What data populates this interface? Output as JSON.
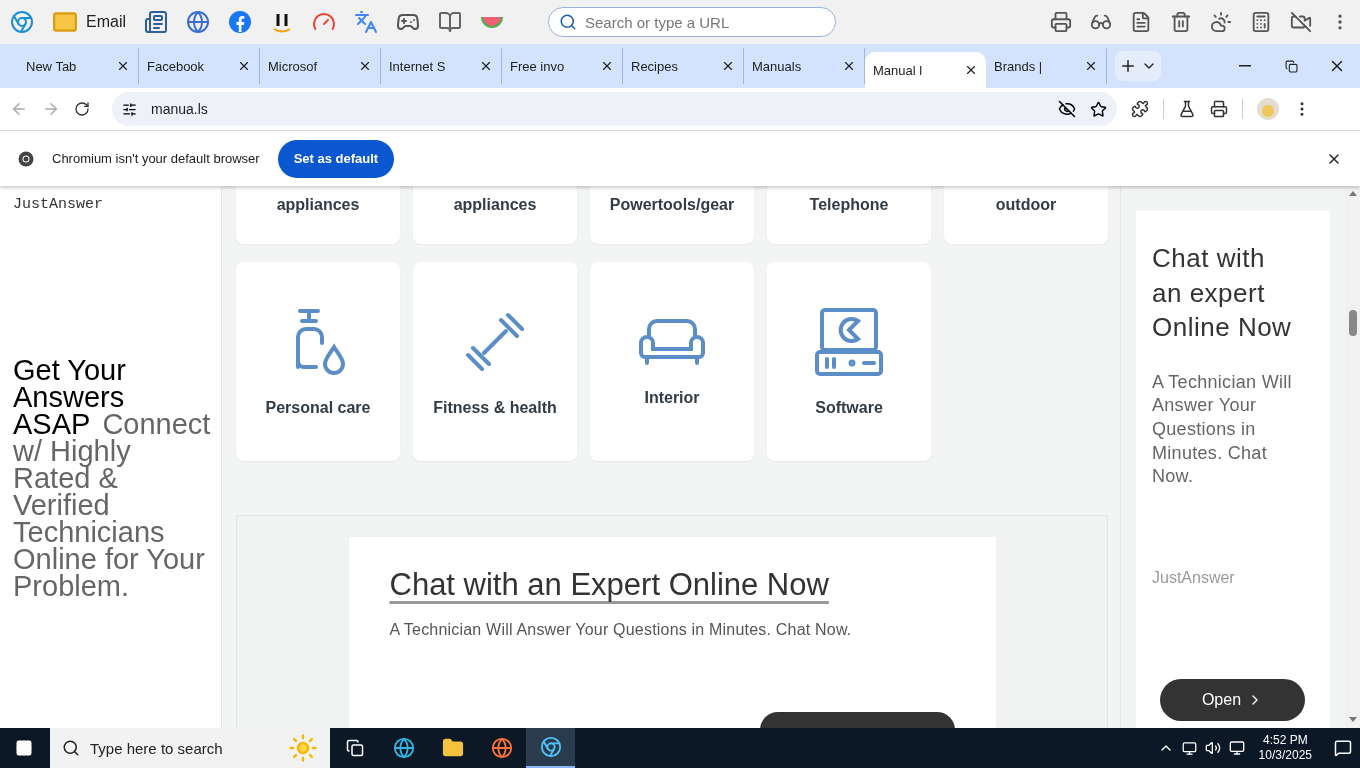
{
  "toolbar": {
    "bookmark_label": "Email",
    "search_placeholder": "Search or type a URL"
  },
  "tabs": [
    {
      "title": "New Tab",
      "selected": false
    },
    {
      "title": "Facebook",
      "selected": false
    },
    {
      "title": "Microsof",
      "selected": false
    },
    {
      "title": "Internet S",
      "selected": false
    },
    {
      "title": "Free invo",
      "selected": false
    },
    {
      "title": "Recipes",
      "selected": false
    },
    {
      "title": "Manuals",
      "selected": false
    },
    {
      "title": "Manual l",
      "selected": true
    },
    {
      "title": "Brands |",
      "selected": false
    }
  ],
  "address": "manua.ls",
  "infobar": {
    "message": "Chromium isn't your default browser",
    "button": "Set as default"
  },
  "left_ad": {
    "brand": "JustAnswer",
    "headline": "Get Your Answers ASAP",
    "text": "Connect w/ Highly Rated & Verified Technicians Online for Your Problem."
  },
  "categories": [
    {
      "kind": "partial",
      "title": "appliances"
    },
    {
      "kind": "partial",
      "title": "appliances"
    },
    {
      "kind": "partial",
      "title": "Powertools/gear"
    },
    {
      "kind": "partial",
      "title": "Telephone"
    },
    {
      "kind": "partial",
      "title": "outdoor"
    },
    {
      "kind": "full",
      "title": "Personal care"
    },
    {
      "kind": "full",
      "title": "Fitness & health"
    },
    {
      "kind": "full",
      "title": "Interior"
    },
    {
      "kind": "full",
      "title": "Software"
    }
  ],
  "center_ad": {
    "title": "Chat with an Expert Online Now",
    "text": "A Technician Will Answer Your Questions in Minutes. Chat Now."
  },
  "right_ad": {
    "title": "Chat with an expert Online Now",
    "text": "A Technician Will Answer Your Questions in Minutes. Chat Now.",
    "brand": "JustAnswer",
    "button": "Open"
  },
  "taskbar": {
    "search_placeholder": "Type here to search",
    "time": "4:52 PM",
    "date": "10/3/2025"
  }
}
